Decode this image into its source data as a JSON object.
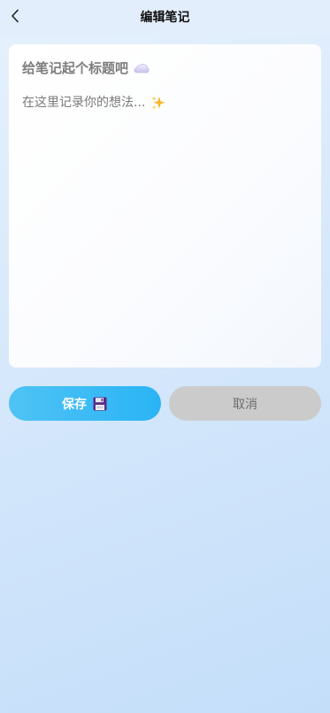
{
  "nav": {
    "title": "编辑笔记",
    "back_icon": "chevron-left-icon"
  },
  "editor": {
    "title_placeholder": "给笔记起个标题吧",
    "title_icon": "cloud-icon",
    "content_placeholder": "在这里记录你的想法...",
    "content_icon": "sparkles-icon"
  },
  "actions": {
    "save_label": "保存",
    "save_icon": "floppy-disk-icon",
    "cancel_label": "取消"
  },
  "colors": {
    "accent": "#2ab4f5",
    "cancel_bg": "#cbcbcb",
    "background": "#d6e8fb"
  }
}
